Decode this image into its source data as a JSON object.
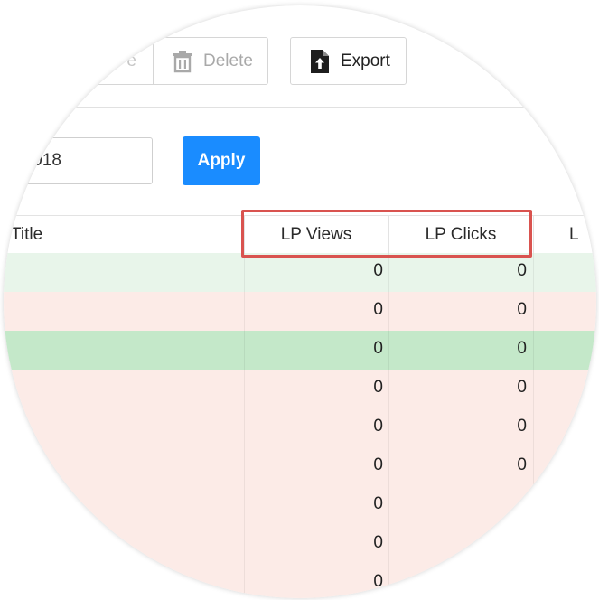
{
  "toolbar": {
    "partial_label": "e",
    "delete_label": "Delete",
    "export_label": "Export"
  },
  "filter": {
    "date_value": ".018",
    "apply_label": "Apply"
  },
  "table": {
    "columns": [
      "Title",
      "LP Views",
      "LP Clicks",
      "L"
    ],
    "rows": [
      {
        "lp_views": "0",
        "lp_clicks": "0",
        "color": "#e8f5ea"
      },
      {
        "lp_views": "0",
        "lp_clicks": "0",
        "color": "#fcebe7"
      },
      {
        "lp_views": "0",
        "lp_clicks": "0",
        "color": "#c4e8c9"
      },
      {
        "lp_views": "0",
        "lp_clicks": "0",
        "color": "#fcebe7"
      },
      {
        "lp_views": "0",
        "lp_clicks": "0",
        "color": "#fcebe7"
      },
      {
        "lp_views": "0",
        "lp_clicks": "0",
        "color": "#fcebe7"
      },
      {
        "lp_views": "0",
        "lp_clicks": "",
        "color": "#fcebe7"
      },
      {
        "lp_views": "0",
        "lp_clicks": "",
        "color": "#fcebe7"
      },
      {
        "lp_views": "0",
        "lp_clicks": "",
        "color": "#fcebe7"
      }
    ]
  },
  "colors": {
    "accent": "#1a8cff",
    "highlight": "#d9534f"
  }
}
